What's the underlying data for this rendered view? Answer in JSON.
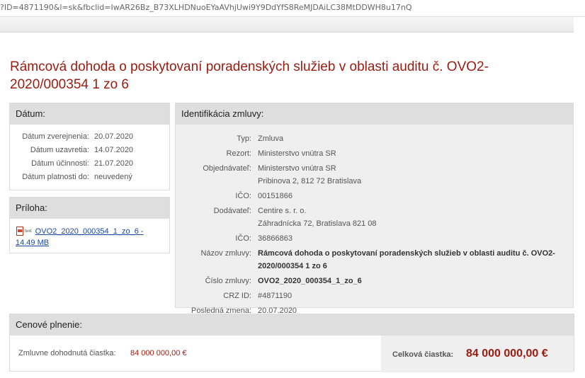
{
  "browser": {
    "url": "?ID=4871190&l=sk&fbclid=IwAR26Bz_B73XLHDNuoEYaAVhjUwi9Y9DdYfS8ReMJDAiLC38MtDDWH8u17nQ"
  },
  "page": {
    "title": "Rámcová dohoda o poskytovaní poradenských služieb v oblasti auditu č. OVO2-2020/000354 1 zo 6"
  },
  "datum": {
    "heading": "Dátum:",
    "rows": [
      {
        "label": "Dátum zverejnenia:",
        "value": "20.07.2020"
      },
      {
        "label": "Dátum uzavretia:",
        "value": "14.07.2020"
      },
      {
        "label": "Dátum účinnosti:",
        "value": "21.07.2020"
      },
      {
        "label": "Dátum platnosti do:",
        "value": "neuvedený"
      }
    ]
  },
  "priloha": {
    "heading": "Príloha:",
    "file_type": "text",
    "file_link": "OVO2_2020_000354_1_zo_6 - 14.49 MB",
    "icon": "pdf-icon"
  },
  "identifikacia": {
    "heading": "Identifikácia zmluvy:",
    "typ_label": "Typ:",
    "typ": "Zmluva",
    "rezort_label": "Rezort:",
    "rezort": "Ministerstvo vnútra SR",
    "objednavatel_label": "Objednávateľ:",
    "objednavatel": "Ministerstvo vnútra SR",
    "objednavatel_adresa": "Pribinova 2, 812 72 Bratislava",
    "ico1_label": "IČO:",
    "ico1": "00151866",
    "dodavatel_label": "Dodávateľ:",
    "dodavatel": "Centire s. r. o.",
    "dodavatel_adresa": "Záhradnícka 72, Bratislava 821 08",
    "ico2_label": "IČO:",
    "ico2": "36866863",
    "nazov_label": "Názov zmluvy:",
    "nazov": "Rámcová dohoda o poskytovaní poradenských služieb v oblasti auditu č. OVO2-2020/000354 1 zo 6",
    "cislo_label": "Číslo zmluvy:",
    "cislo": "OVO2_2020_000354_1_zo_6",
    "crz_label": "CRZ ID:",
    "crz": "#4871190",
    "zmena_label": "Posledná zmena:",
    "zmena": "20.07.2020"
  },
  "cena": {
    "heading": "Cenové plnenie:",
    "dohodnuta_label": "Zmluvne dohodnutá čiastka:",
    "dohodnuta_value": "84 000 000,00 €",
    "celkova_label": "Celková čiastka:",
    "celkova_value": "84 000 000,00 €"
  },
  "colors": {
    "accent_red": "#9b1b10",
    "panel_header": "#dedede",
    "link_blue": "#1a4aa0"
  }
}
